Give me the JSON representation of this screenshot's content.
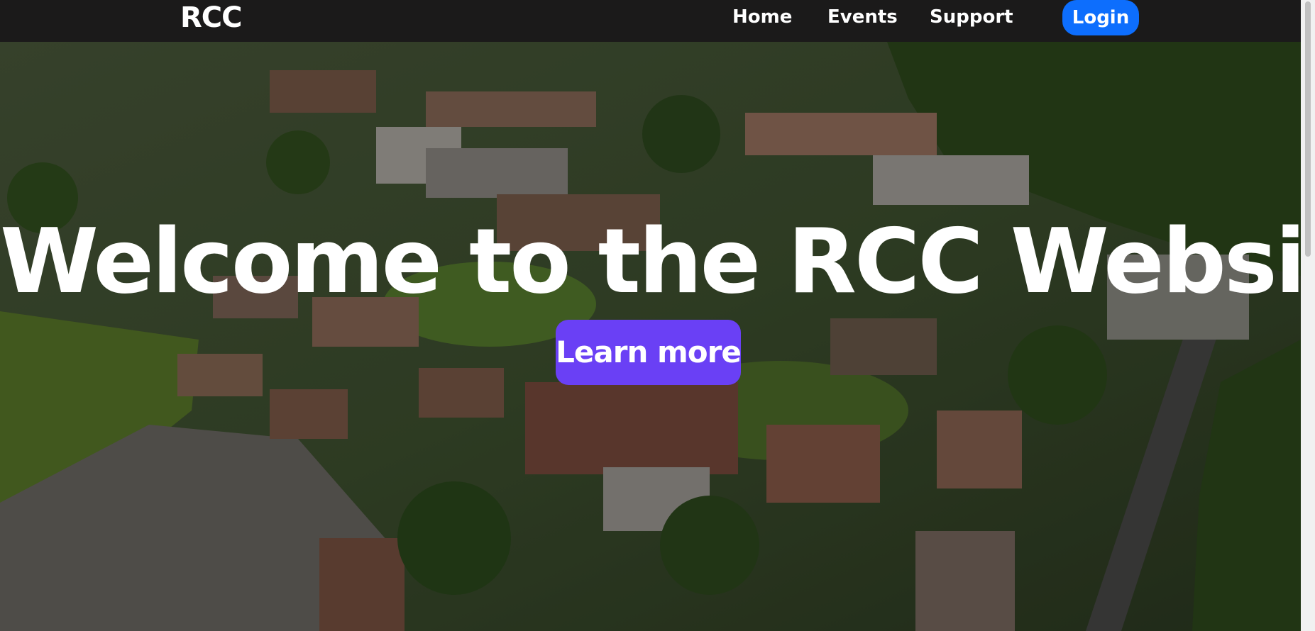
{
  "navbar": {
    "brand": "RCC",
    "links": {
      "home": "Home",
      "events": "Events",
      "support": "Support"
    },
    "login_label": "Login"
  },
  "hero": {
    "title": "Welcome to the RCC Website",
    "button_label": "Learn more"
  },
  "colors": {
    "navbar_bg": "#1b1a1a",
    "login_bg": "#0d6efd",
    "learn_more_bg": "#6a40f5",
    "text": "#ffffff"
  }
}
